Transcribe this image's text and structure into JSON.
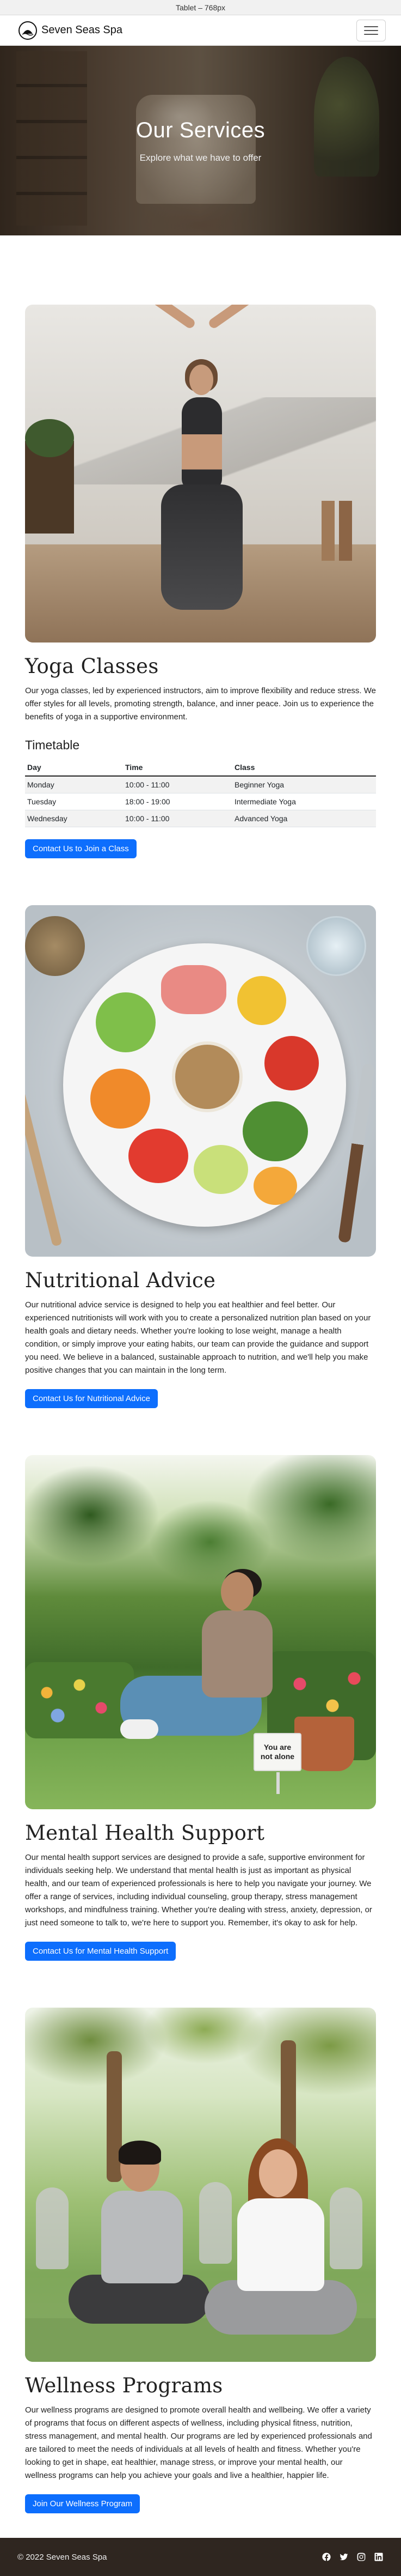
{
  "device_bar": "Tablet – 768px",
  "nav": {
    "brand": "Seven Seas Spa",
    "toggle_icon": "hamburger-icon"
  },
  "hero": {
    "title": "Our Services",
    "subtitle": "Explore what we have to offer"
  },
  "yoga": {
    "title": "Yoga Classes",
    "text": "Our yoga classes, led by experienced instructors, aim to improve flexibility and reduce stress. We offer styles for all levels, promoting strength, balance, and inner peace. Join us to experience the benefits of yoga in a supportive environment.",
    "timetable_title": "Timetable",
    "columns": [
      "Day",
      "Time",
      "Class"
    ],
    "rows": [
      [
        "Monday",
        "10:00 - 11:00",
        "Beginner Yoga"
      ],
      [
        "Tuesday",
        "18:00 - 19:00",
        "Intermediate Yoga"
      ],
      [
        "Wednesday",
        "10:00 - 11:00",
        "Advanced Yoga"
      ]
    ],
    "button": "Contact Us to Join a Class"
  },
  "nutrition": {
    "title": "Nutritional Advice",
    "text": "Our nutritional advice service is designed to help you eat healthier and feel better. Our experienced nutritionists will work with you to create a personalized nutrition plan based on your health goals and dietary needs. Whether you're looking to lose weight, manage a health condition, or simply improve your eating habits, our team can provide the guidance and support you need. We believe in a balanced, sustainable approach to nutrition, and we'll help you make positive changes that you can maintain in the long term.",
    "button": "Contact Us for Nutritional Advice"
  },
  "mental": {
    "title": "Mental Health Support",
    "sign_line1": "You are",
    "sign_line2": "not alone",
    "text": "Our mental health support services are designed to provide a safe, supportive environment for individuals seeking help. We understand that mental health is just as important as physical health, and our team of experienced professionals is here to help you navigate your journey. We offer a range of services, including individual counseling, group therapy, stress management workshops, and mindfulness training. Whether you're dealing with stress, anxiety, depression, or just need someone to talk to, we're here to support you. Remember, it's okay to ask for help.",
    "button": "Contact Us for Mental Health Support"
  },
  "wellness": {
    "title": "Wellness Programs",
    "text": "Our wellness programs are designed to promote overall health and wellbeing. We offer a variety of programs that focus on different aspects of wellness, including physical fitness, nutrition, stress management, and mental health. Our programs are led by experienced professionals and are tailored to meet the needs of individuals at all levels of health and fitness. Whether you're looking to get in shape, eat healthier, manage stress, or improve your mental health, our wellness programs can help you achieve your goals and live a healthier, happier life.",
    "button": "Join Our Wellness Program"
  },
  "footer": {
    "copyright": "© 2022 Seven Seas Spa",
    "social": [
      "facebook-icon",
      "twitter-icon",
      "instagram-icon",
      "linkedin-icon"
    ]
  },
  "colors": {
    "primary": "#0d6efd",
    "footer_bg": "#2f2620"
  }
}
